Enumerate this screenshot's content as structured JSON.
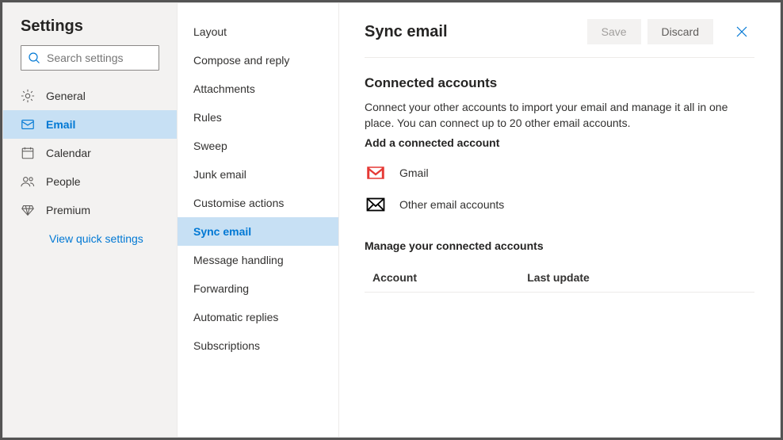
{
  "title": "Settings",
  "search_placeholder": "Search settings",
  "nav": [
    {
      "label": "General",
      "icon": "gear"
    },
    {
      "label": "Email",
      "icon": "mail"
    },
    {
      "label": "Calendar",
      "icon": "calendar"
    },
    {
      "label": "People",
      "icon": "people"
    },
    {
      "label": "Premium",
      "icon": "diamond"
    }
  ],
  "quick_link": "View quick settings",
  "subnav": [
    "Layout",
    "Compose and reply",
    "Attachments",
    "Rules",
    "Sweep",
    "Junk email",
    "Customise actions",
    "Sync email",
    "Message handling",
    "Forwarding",
    "Automatic replies",
    "Subscriptions"
  ],
  "main": {
    "title": "Sync email",
    "save": "Save",
    "discard": "Discard",
    "connected": {
      "heading": "Connected accounts",
      "desc": "Connect your other accounts to import your email and manage it all in one place. You can connect up to 20 other email accounts.",
      "add_label": "Add a connected account",
      "options": [
        {
          "label": "Gmail",
          "icon": "gmail"
        },
        {
          "label": "Other email accounts",
          "icon": "envelope"
        }
      ],
      "manage_heading": "Manage your connected accounts",
      "table_cols": [
        "Account",
        "Last update"
      ]
    }
  }
}
